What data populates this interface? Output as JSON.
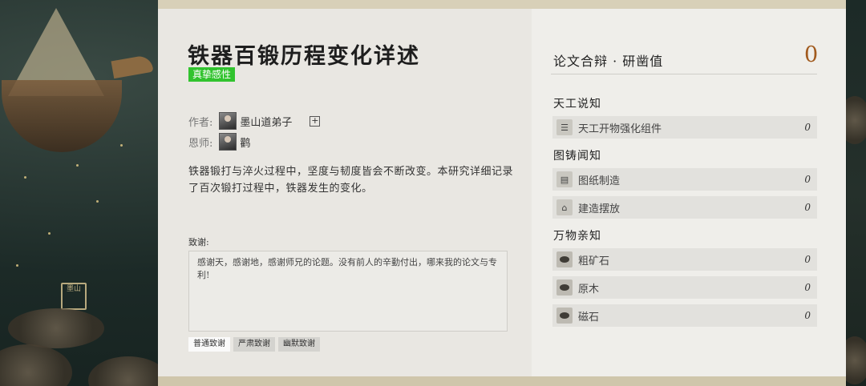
{
  "paper": {
    "title": "铁器百锻历程变化详述",
    "badge": "真挚感性",
    "author_label": "作者:",
    "author_name": "墨山道弟子",
    "mentor_label": "恩师:",
    "mentor_name": "鹳",
    "description": "铁器锻打与淬火过程中，坚度与韧度皆会不断改变。本研究详细记录了百次锻打过程中，铁器发生的变化。",
    "thanks_label": "致谢:",
    "thanks_text": "感谢天，感谢地，感谢师兄的论题。没有前人的辛勤付出，哪来我的论文与专利!",
    "tones": [
      "普通致谢",
      "严肃致谢",
      "幽默致谢"
    ]
  },
  "debate": {
    "header": "论文合辩 · 研凿值",
    "score": "0",
    "sections": [
      {
        "title": "天工说知",
        "items": [
          {
            "name": "天工开物强化组件",
            "value": "0",
            "icon": "scroll-icon"
          }
        ]
      },
      {
        "title": "图铸闻知",
        "items": [
          {
            "name": "图纸制造",
            "value": "0",
            "icon": "blueprint-icon"
          },
          {
            "name": "建造摆放",
            "value": "0",
            "icon": "build-icon"
          }
        ]
      },
      {
        "title": "万物亲知",
        "items": [
          {
            "name": "粗矿石",
            "value": "0",
            "icon": "ore-icon"
          },
          {
            "name": "原木",
            "value": "0",
            "icon": "log-icon"
          },
          {
            "name": "磁石",
            "value": "0",
            "icon": "magnet-icon"
          }
        ]
      }
    ]
  },
  "scene": {
    "seal_text": "墨山"
  }
}
